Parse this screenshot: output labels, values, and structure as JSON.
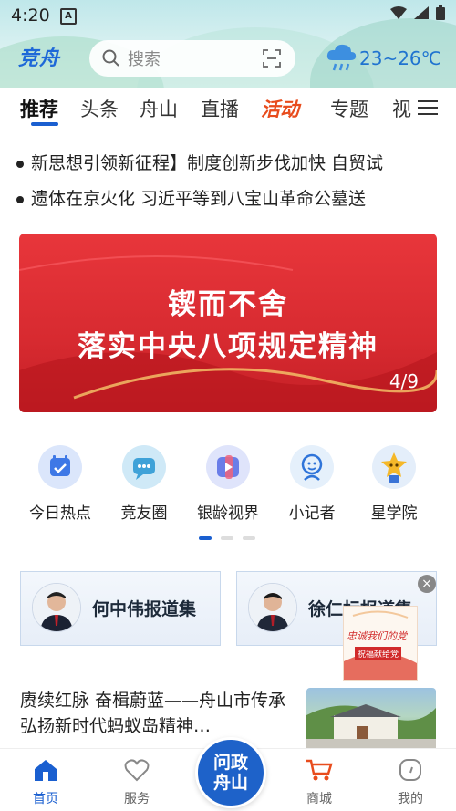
{
  "status_bar": {
    "time": "4:20"
  },
  "header": {
    "logo": "竞舟",
    "search_placeholder": "搜索",
    "weather": "23~26℃"
  },
  "tabs": [
    {
      "label": "推荐",
      "active": true
    },
    {
      "label": "头条"
    },
    {
      "label": "舟山"
    },
    {
      "label": "直播"
    },
    {
      "label": "活动"
    },
    {
      "label": "专题"
    },
    {
      "label": "视"
    }
  ],
  "headlines": [
    "新思想引领新征程】制度创新步伐加快  自贸试",
    "遗体在京火化  习近平等到八宝山革命公墓送"
  ],
  "banner": {
    "line1": "锲而不舍",
    "line2": "落实中央八项规定精神",
    "counter": "4/9",
    "current": 4,
    "total": 9
  },
  "quick_entries": [
    {
      "label": "今日热点",
      "icon": "calendar-check-icon"
    },
    {
      "label": "竞友圈",
      "icon": "chat-bubble-icon"
    },
    {
      "label": "银龄视界",
      "icon": "play-video-icon"
    },
    {
      "label": "小记者",
      "icon": "reporter-icon"
    },
    {
      "label": "星学院",
      "icon": "star-mascot-icon"
    }
  ],
  "report_cards": [
    {
      "title": "何中伟报道集"
    },
    {
      "title": "徐仁标报道集"
    }
  ],
  "float_promo": {
    "close": "×",
    "text1": "忠诚我们的党",
    "text2": "祝福献给党"
  },
  "article": {
    "title": "赓续红脉  奋楫蔚蓝——舟山市传承弘扬新时代蚂蚁岛精神…"
  },
  "bottom_nav": [
    {
      "label": "首页",
      "active": true
    },
    {
      "label": "服务"
    },
    {
      "label": "商城"
    },
    {
      "label": "我的"
    }
  ],
  "center_button": {
    "line1": "问政",
    "line2": "舟山"
  },
  "colors": {
    "brand_blue": "#1a5fd0",
    "activity_orange": "#e84c1d",
    "banner_red": "#d72a30"
  }
}
